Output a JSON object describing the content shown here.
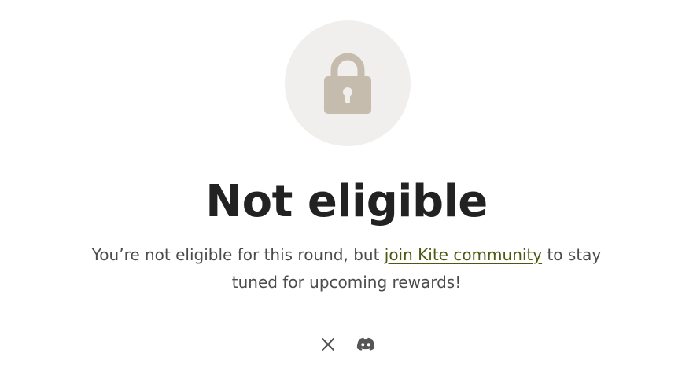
{
  "colors": {
    "lock_circle_bg": "#f0efed",
    "lock_icon": "#c5bcad",
    "title_text": "#222222",
    "body_text": "#4b4b4b",
    "link": "#4a5a10",
    "social_icon": "#555555"
  },
  "hero": {
    "icon": "lock-icon"
  },
  "title": "Not eligible",
  "message": {
    "before_link": "You’re not eligible for this round, but ",
    "link_text": "join Kite community",
    "after_link": " to stay tuned for upcoming rewards!"
  },
  "socials": [
    {
      "icon": "x-icon"
    },
    {
      "icon": "discord-icon"
    }
  ]
}
